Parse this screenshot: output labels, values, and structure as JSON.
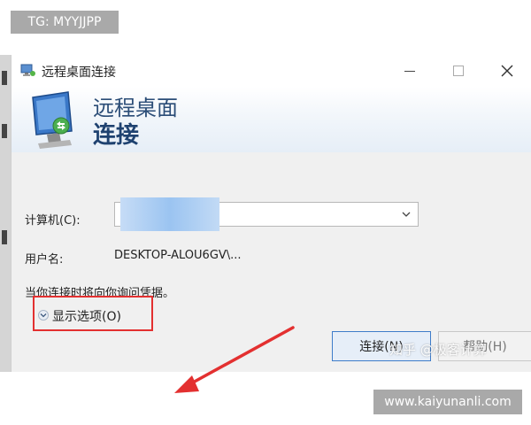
{
  "overlay": {
    "tg_badge": "TG: MYYJJPP",
    "url_badge": "www.kaiyunanli.com",
    "watermark": "知乎 @极客计算"
  },
  "window": {
    "title": "远程桌面连接",
    "banner_title": "远程桌面",
    "banner_subtitle": "连接"
  },
  "form": {
    "computer_label": "计算机(C):",
    "computer_value": "",
    "username_label": "用户名:",
    "username_value": "DESKTOP-ALOU6GV\\...",
    "hint": "当你连接时将向你询问凭据。"
  },
  "buttons": {
    "show_options": "显示选项(O)",
    "connect": "连接(N)",
    "help": "帮助(H)"
  },
  "colors": {
    "highlight": "#e33030",
    "banner_text": "#1f4270",
    "button_border": "#3e7cc9"
  }
}
